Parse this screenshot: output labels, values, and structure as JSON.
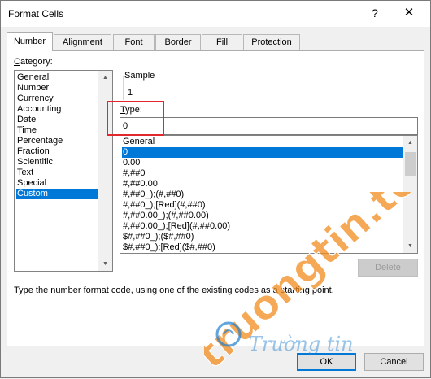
{
  "window": {
    "title": "Format Cells",
    "help_glyph": "?",
    "close_glyph": "✕"
  },
  "tabs": [
    {
      "label": "Number",
      "active": true
    },
    {
      "label": "Alignment",
      "active": false
    },
    {
      "label": "Font",
      "active": false
    },
    {
      "label": "Border",
      "active": false
    },
    {
      "label": "Fill",
      "active": false
    },
    {
      "label": "Protection",
      "active": false
    }
  ],
  "category": {
    "label_prefix": "",
    "label_mnemonic": "C",
    "label_rest": "ategory:",
    "items": [
      "General",
      "Number",
      "Currency",
      "Accounting",
      "Date",
      "Time",
      "Percentage",
      "Fraction",
      "Scientific",
      "Text",
      "Special",
      "Custom"
    ],
    "selected": "Custom"
  },
  "sample": {
    "label": "Sample",
    "value": "1"
  },
  "type": {
    "label_mnemonic": "T",
    "label_rest": "ype:",
    "value": "0"
  },
  "formats": {
    "items": [
      "General",
      "0",
      "0.00",
      "#,##0",
      "#,##0.00",
      "#,##0_);(#,##0)",
      "#,##0_);[Red](#,##0)",
      "#,##0.00_);(#,##0.00)",
      "#,##0.00_);[Red](#,##0.00)",
      "$#,##0_);($#,##0)",
      "$#,##0_);[Red]($#,##0)"
    ],
    "selected": "0"
  },
  "buttons": {
    "delete": "Delete",
    "ok": "OK",
    "cancel": "Cancel"
  },
  "description": "Type the number format code, using one of the existing codes as a starting point.",
  "watermark": {
    "brand": "truongtin.top",
    "script": "Trường tin"
  },
  "colors": {
    "selection": "#0078d7",
    "highlight_box": "#e0282e",
    "watermark_orange": "#f28c1e",
    "watermark_blue": "#1f7fd1"
  }
}
